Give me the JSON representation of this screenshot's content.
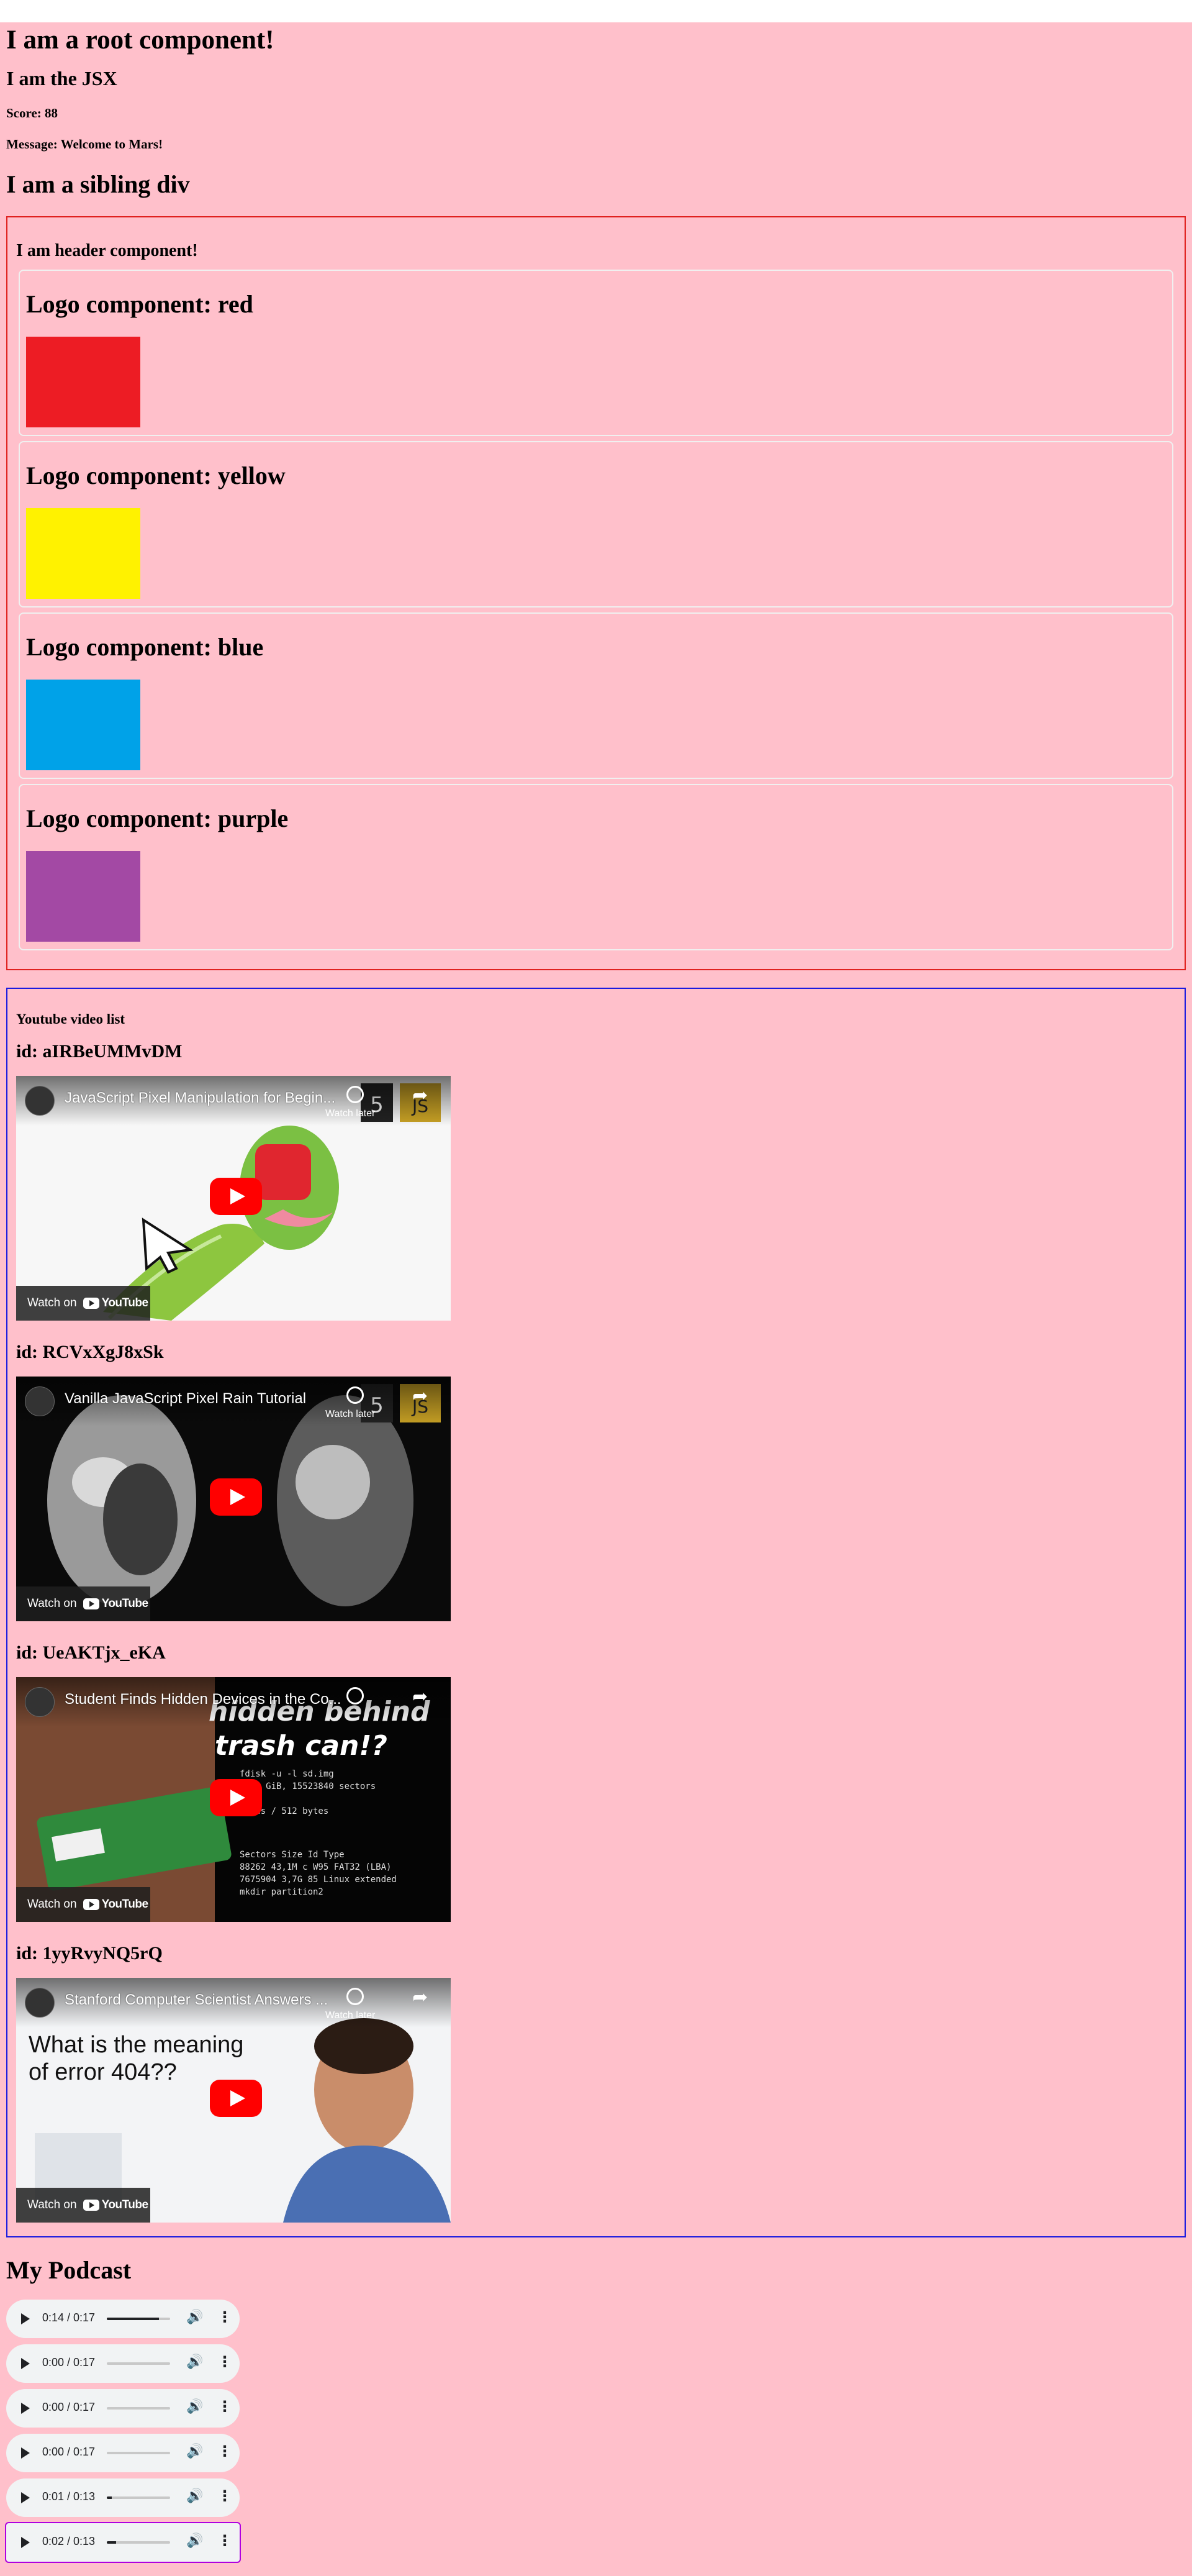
{
  "root": {
    "title": "I am a root component!",
    "jsx": "I am the JSX",
    "score": "Score: 88",
    "message": "Message: Welcome to Mars!",
    "sibling": "I am a sibling div"
  },
  "header": {
    "title": "I am header component!",
    "logos": [
      {
        "label": "Logo component: red",
        "color": "#ed1c24"
      },
      {
        "label": "Logo component: yellow",
        "color": "#fff200"
      },
      {
        "label": "Logo component: blue",
        "color": "#00a2e8"
      },
      {
        "label": "Logo component: purple",
        "color": "#a349a4"
      }
    ]
  },
  "youtube": {
    "title": "Youtube video list",
    "watch_on": "Watch on",
    "youtube_word": "YouTube",
    "watch_later": "Watch later",
    "share": "Share",
    "videos": [
      {
        "id_label": "id: aIRBeUMMvDM",
        "title": "JavaScript Pixel Manipulation for Begin..."
      },
      {
        "id_label": "id: RCVxXgJ8xSk",
        "title": "Vanilla JavaScript Pixel Rain Tutorial"
      },
      {
        "id_label": "id: UeAKTjx_eKA",
        "title": "Student Finds Hidden Devices in the Co..."
      },
      {
        "id_label": "id: 1yyRvyNQ5rQ",
        "title": "Stanford Computer Scientist Answers ..."
      }
    ],
    "thumb3_overlay": "hidden behind trash can!?",
    "thumb4_text": "What is the meaning of error 404??"
  },
  "podcast": {
    "title": "My Podcast",
    "players": [
      {
        "time": "0:14 / 0:17",
        "progress": 0.82
      },
      {
        "time": "0:00 / 0:17",
        "progress": 0.0
      },
      {
        "time": "0:00 / 0:17",
        "progress": 0.0
      },
      {
        "time": "0:00 / 0:17",
        "progress": 0.0
      },
      {
        "time": "0:01 / 0:13",
        "progress": 0.08
      },
      {
        "time": "0:02 / 0:13",
        "progress": 0.15
      }
    ]
  }
}
